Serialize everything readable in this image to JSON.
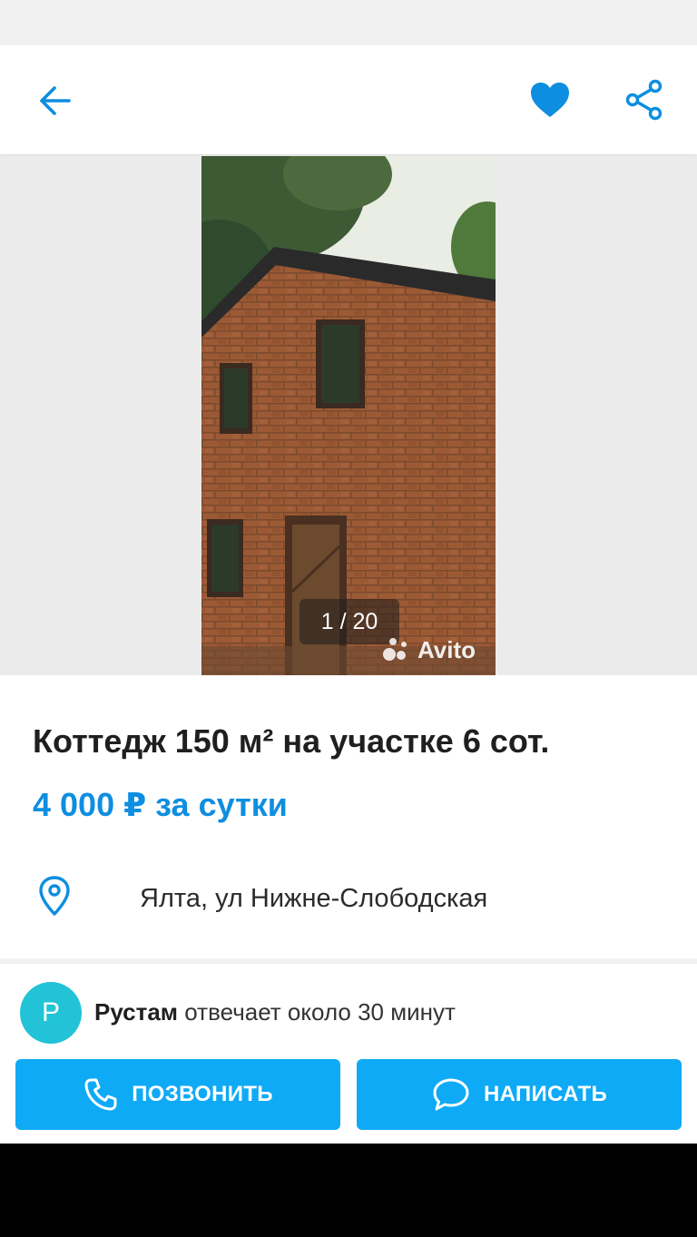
{
  "toolbar": {
    "back_icon": "arrow-left-icon",
    "favorite_icon": "heart-icon",
    "share_icon": "share-icon",
    "accent_color": "#0e8ee0"
  },
  "gallery": {
    "counter": "1 / 20",
    "watermark": "Avito"
  },
  "listing": {
    "title": "Коттедж 150 м² на участке 6 сот.",
    "price": "4 000 ₽ за сутки",
    "address": "Ялта, ул Нижне-Слободская",
    "location_icon": "map-pin-icon"
  },
  "seller": {
    "avatar_letter": "Р",
    "name": "Рустам",
    "response_time": "отвечает около 30 минут"
  },
  "actions": {
    "call_label": "ПОЗВОНИТЬ",
    "write_label": "НАПИСАТЬ",
    "button_color": "#0faaf6"
  }
}
